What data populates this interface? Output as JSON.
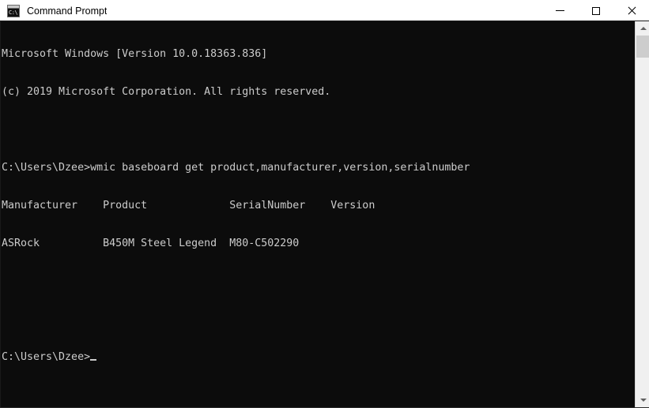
{
  "window": {
    "title": "Command Prompt",
    "icon_name": "command-prompt-icon",
    "icon_text": "C:\\",
    "background_color": "#0c0c0c",
    "titlebar_color": "#ffffff",
    "text_color": "#cccccc"
  },
  "controls": {
    "minimize_label": "Minimize",
    "maximize_label": "Maximize",
    "close_label": "Close"
  },
  "terminal": {
    "lines": [
      "Microsoft Windows [Version 10.0.18363.836]",
      "(c) 2019 Microsoft Corporation. All rights reserved.",
      "",
      "C:\\Users\\Dzee>wmic baseboard get product,manufacturer,version,serialnumber",
      "Manufacturer    Product             SerialNumber    Version",
      "ASRock          B450M Steel Legend  M80-C502290",
      "",
      ""
    ],
    "prompt": "C:\\Users\\Dzee>",
    "cursor": "_",
    "banner": {
      "os_line": "Microsoft Windows [Version 10.0.18363.836]",
      "version": "10.0.18363.836",
      "copyright_line": "(c) 2019 Microsoft Corporation. All rights reserved.",
      "copyright_year": "2019"
    },
    "command": {
      "prompt": "C:\\Users\\Dzee>",
      "text": "wmic baseboard get product,manufacturer,version,serialnumber"
    },
    "result_table": {
      "headers": [
        "Manufacturer",
        "Product",
        "SerialNumber",
        "Version"
      ],
      "rows": [
        [
          "ASRock",
          "B450M Steel Legend",
          "M80-C502290",
          ""
        ]
      ]
    }
  },
  "scrollbar": {
    "up_arrow_name": "scroll-up-arrow",
    "down_arrow_name": "scroll-down-arrow",
    "thumb_name": "scrollbar-thumb"
  }
}
